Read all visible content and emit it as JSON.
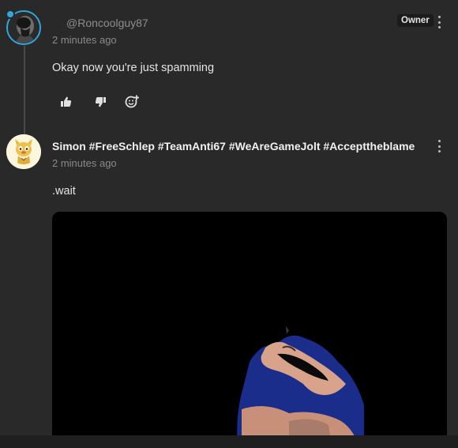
{
  "comments": [
    {
      "username": "@Roncoolguy87",
      "timestamp": "2 minutes ago",
      "badge": "Owner",
      "text": "Okay now you're just spamming",
      "actions": [
        "thumbs-up-icon",
        "thumbs-down-icon",
        "add-reaction-icon"
      ]
    },
    {
      "username": "Simon #FreeSchlep #TeamAnti67 #WeAreGameJolt #Accepttheblame",
      "timestamp": "2 minutes ago",
      "text": ".wait",
      "media": "video"
    }
  ],
  "colors": {
    "background": "#292929",
    "accent": "#2fa8de",
    "badge_bg": "#1b1b1b"
  }
}
